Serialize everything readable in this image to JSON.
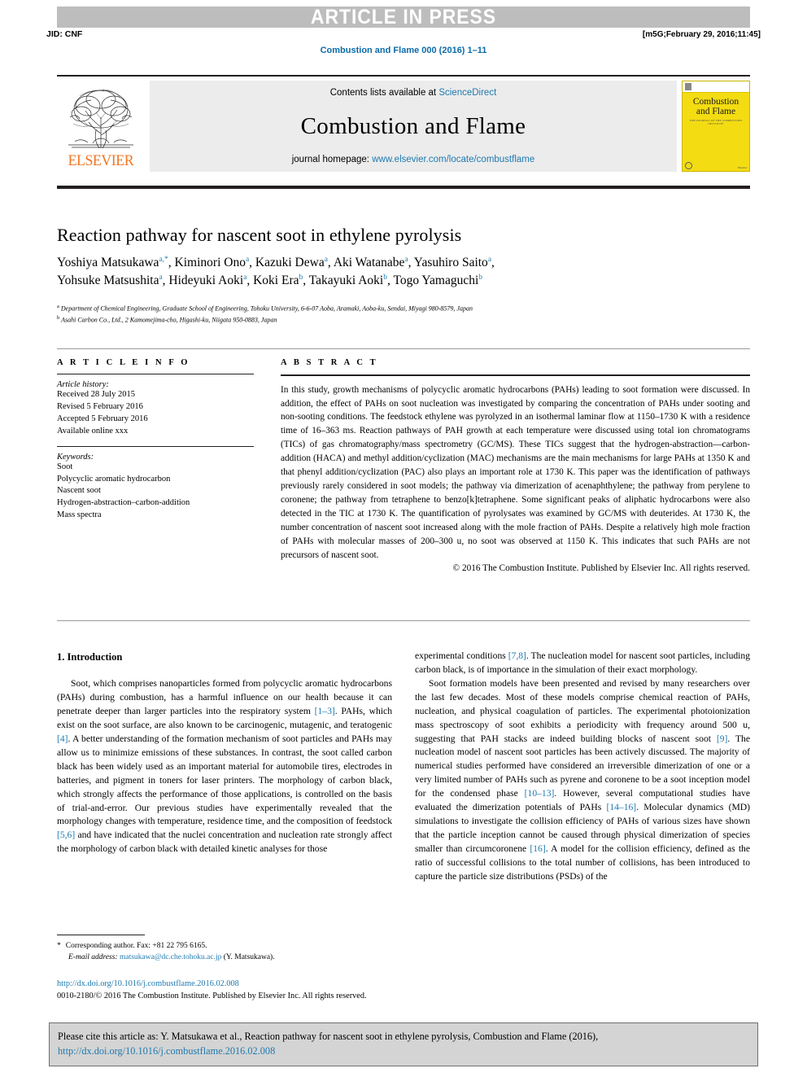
{
  "banner": {
    "text": "ARTICLE IN PRESS"
  },
  "jid": {
    "left": "JID: CNF",
    "right": "[m5G;February 29, 2016;11:45]"
  },
  "running_head": {
    "text": "Combustion and Flame 000 (2016) 1–11"
  },
  "masthead": {
    "publisher_logo_text": "ELSEVIER",
    "contents_prefix": "Contents lists available at ",
    "contents_link": "ScienceDirect",
    "journal_name": "Combustion and Flame",
    "homepage_prefix": "journal homepage: ",
    "homepage_link": "www.elsevier.com/locate/combustflame",
    "cover": {
      "title_line1": "Combustion",
      "title_line2": "and Flame",
      "subtitle": "THE JOURNAL OF THE COMBUSTION INSTITUTE",
      "footer": "Elsevier"
    }
  },
  "article": {
    "title": "Reaction pathway for nascent soot in ethylene pyrolysis",
    "authors_line1": "Yoshiya Matsukawa",
    "authors_line1_sup": "a,*",
    "authors": [
      {
        "name": "Yoshiya Matsukawa",
        "sup": "a,*"
      },
      {
        "name": "Kiminori Ono",
        "sup": "a"
      },
      {
        "name": "Kazuki Dewa",
        "sup": "a"
      },
      {
        "name": "Aki Watanabe",
        "sup": "a"
      },
      {
        "name": "Yasuhiro Saito",
        "sup": "a"
      },
      {
        "name": "Yohsuke Matsushita",
        "sup": "a"
      },
      {
        "name": "Hideyuki Aoki",
        "sup": "a"
      },
      {
        "name": "Koki Era",
        "sup": "b"
      },
      {
        "name": "Takayuki Aoki",
        "sup": "b"
      },
      {
        "name": "Togo Yamaguchi",
        "sup": "b"
      }
    ],
    "affiliations": [
      {
        "sup": "a",
        "text": "Department of Chemical Engineering, Graduate School of Engineering, Tohoku University, 6-6-07 Aoba, Aramaki, Aoba-ku, Sendai, Miyagi 980-8579, Japan"
      },
      {
        "sup": "b",
        "text": "Asahi Carbon Co., Ltd., 2 Kamomejima-cho, Higashi-ku, Niigata 950-0883, Japan"
      }
    ]
  },
  "article_info": {
    "heading": "A R T I C L E   I N F O",
    "history_label": "Article history:",
    "history": [
      "Received 28 July 2015",
      "Revised 5 February 2016",
      "Accepted 5 February 2016",
      "Available online xxx"
    ],
    "keywords_label": "Keywords:",
    "keywords": [
      "Soot",
      "Polycyclic aromatic hydrocarbon",
      "Nascent soot",
      "Hydrogen-abstraction–carbon-addition",
      "Mass spectra"
    ]
  },
  "abstract": {
    "heading": "A B S T R A C T",
    "text": "In this study, growth mechanisms of polycyclic aromatic hydrocarbons (PAHs) leading to soot formation were discussed. In addition, the effect of PAHs on soot nucleation was investigated by comparing the concentration of PAHs under sooting and non-sooting conditions. The feedstock ethylene was pyrolyzed in an isothermal laminar flow at 1150–1730 K with a residence time of 16–363 ms. Reaction pathways of PAH growth at each temperature were discussed using total ion chromatograms (TICs) of gas chromatography/mass spectrometry (GC/MS). These TICs suggest that the hydrogen-abstraction—carbon-addition (HACA) and methyl addition/cyclization (MAC) mechanisms are the main mechanisms for large PAHs at 1350 K and that phenyl addition/cyclization (PAC) also plays an important role at 1730 K. This paper was the identification of pathways previously rarely considered in soot models; the pathway via dimerization of acenaphthylene; the pathway from perylene to coronene; the pathway from tetraphene to benzo[k]tetraphene. Some significant peaks of aliphatic hydrocarbons were also detected in the TIC at 1730 K. The quantification of pyrolysates was examined by GC/MS with deuterides. At 1730 K, the number concentration of nascent soot increased along with the mole fraction of PAHs. Despite a relatively high mole fraction of PAHs with molecular masses of 200–300 u, no soot was observed at 1150 K. This indicates that such PAHs are not precursors of nascent soot.",
    "copyright": "© 2016 The Combustion Institute. Published by Elsevier Inc. All rights reserved."
  },
  "body": {
    "section_heading": "1. Introduction",
    "left_paragraph_1_a": "Soot, which comprises nanoparticles formed from polycyclic aromatic hydrocarbons (PAHs) during combustion, has a harmful influence on our health because it can penetrate deeper than larger particles into the respiratory system ",
    "ref_1_3": "[1–3]",
    "left_paragraph_1_b": ". PAHs, which exist on the soot surface, are also known to be carcinogenic, mutagenic, and teratogenic ",
    "ref_4": "[4]",
    "left_paragraph_1_c": ". A better understanding of the formation mechanism of soot particles and PAHs may allow us to minimize emissions of these substances. In contrast, the soot called carbon black has been widely used as an important material for automobile tires, electrodes in batteries, and pigment in toners for laser printers. The morphology of carbon black, which strongly affects the performance of those applications, is controlled on the basis of trial-and-error. Our previous studies have experimentally revealed that the morphology changes with temperature, residence time, and the composition of feedstock ",
    "ref_5_6": "[5,6]",
    "left_paragraph_1_d": " and have indicated that the nuclei concentration and nucleation rate strongly affect the morphology of carbon black with detailed kinetic analyses for those",
    "right_paragraph_1_a": "experimental conditions ",
    "ref_7_8": "[7,8]",
    "right_paragraph_1_b": ". The nucleation model for nascent soot particles, including carbon black, is of importance in the simulation of their exact morphology.",
    "right_paragraph_2_a": "Soot formation models have been presented and revised by many researchers over the last few decades. Most of these models comprise chemical reaction of PAHs, nucleation, and physical coagulation of particles. The experimental photoionization mass spectroscopy of soot exhibits a periodicity with frequency around 500 u, suggesting that PAH stacks are indeed building blocks of nascent soot ",
    "ref_9": "[9]",
    "right_paragraph_2_b": ". The nucleation model of nascent soot particles has been actively discussed. The majority of numerical studies performed have considered an irreversible dimerization of one or a very limited number of PAHs such as pyrene and coronene to be a soot inception model for the condensed phase ",
    "ref_10_13": "[10–13]",
    "right_paragraph_2_c": ". However, several computational studies have evaluated the dimerization potentials of PAHs ",
    "ref_14_16": "[14–16]",
    "right_paragraph_2_d": ". Molecular dynamics (MD) simulations to investigate the collision efficiency of PAHs of various sizes have shown that the particle inception cannot be caused through physical dimerization of species smaller than circumcoronene ",
    "ref_16": "[16]",
    "right_paragraph_2_e": ". A model for the collision efficiency, defined as the ratio of successful collisions to the total number of collisions, has been introduced to capture the particle size distributions (PSDs) of the"
  },
  "footnote": {
    "star": "*",
    "corresponding": "Corresponding author. Fax: +81 22 795 6165.",
    "email_label": "E-mail address:",
    "email": "matsukawa@dc.che.tohoku.ac.jp",
    "email_owner": "(Y. Matsukawa)."
  },
  "footer": {
    "doi": "http://dx.doi.org/10.1016/j.combustflame.2016.02.008",
    "issn_line": "0010-2180/© 2016 The Combustion Institute. Published by Elsevier Inc. All rights reserved."
  },
  "citation_box": {
    "text": "Please cite this article as: Y. Matsukawa et al., Reaction pathway for nascent soot in ethylene pyrolysis, Combustion and Flame (2016),",
    "doi": "http://dx.doi.org/10.1016/j.combustflame.2016.02.008"
  },
  "colors": {
    "link": "#1f7ab0",
    "banner_bg": "#bdbdbd",
    "elsevier_orange": "#ef7622",
    "cover_yellow": "#f3dc12",
    "citation_bg": "#d4d4d4"
  }
}
